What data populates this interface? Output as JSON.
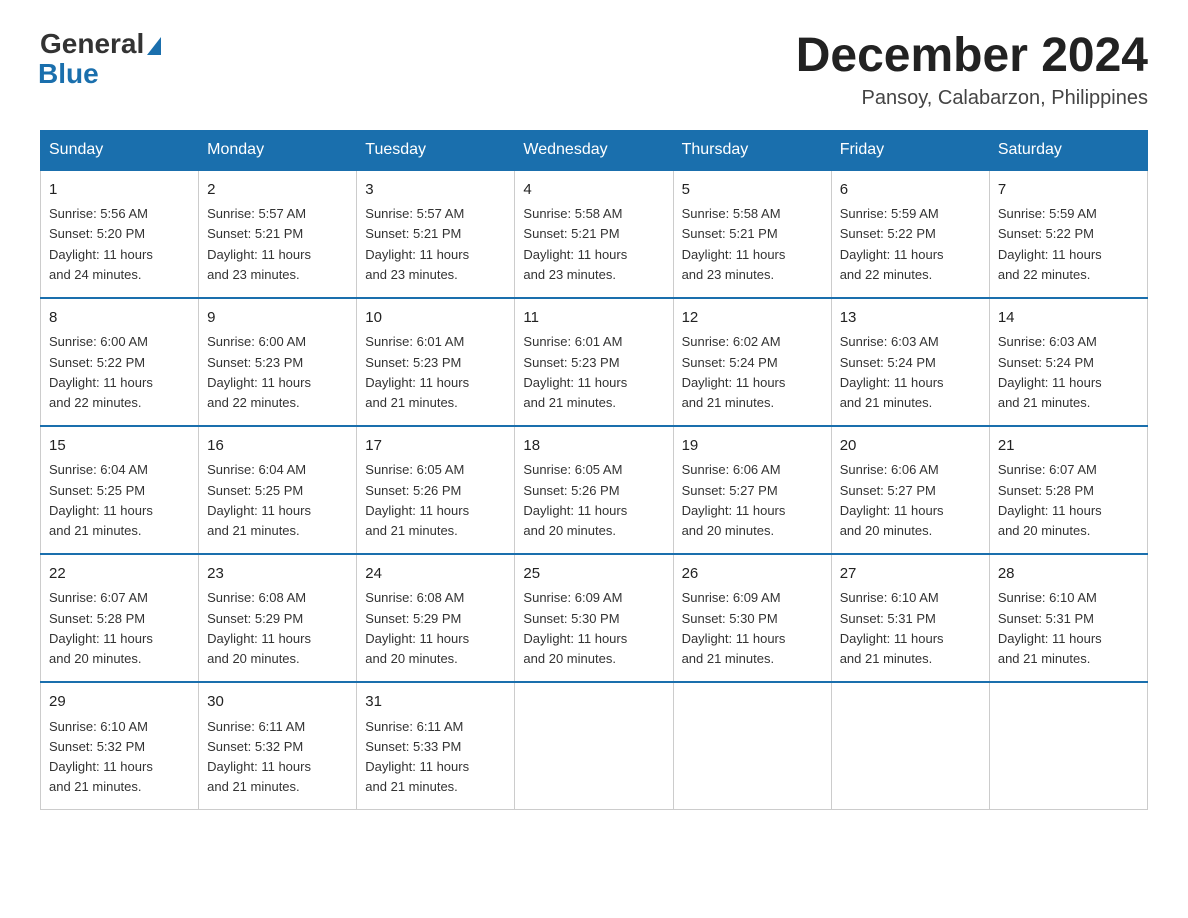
{
  "header": {
    "logo_general": "General",
    "logo_blue": "Blue",
    "month_title": "December 2024",
    "subtitle": "Pansoy, Calabarzon, Philippines"
  },
  "weekdays": [
    "Sunday",
    "Monday",
    "Tuesday",
    "Wednesday",
    "Thursday",
    "Friday",
    "Saturday"
  ],
  "weeks": [
    [
      {
        "day": "1",
        "sunrise": "5:56 AM",
        "sunset": "5:20 PM",
        "daylight": "11 hours and 24 minutes."
      },
      {
        "day": "2",
        "sunrise": "5:57 AM",
        "sunset": "5:21 PM",
        "daylight": "11 hours and 23 minutes."
      },
      {
        "day": "3",
        "sunrise": "5:57 AM",
        "sunset": "5:21 PM",
        "daylight": "11 hours and 23 minutes."
      },
      {
        "day": "4",
        "sunrise": "5:58 AM",
        "sunset": "5:21 PM",
        "daylight": "11 hours and 23 minutes."
      },
      {
        "day": "5",
        "sunrise": "5:58 AM",
        "sunset": "5:21 PM",
        "daylight": "11 hours and 23 minutes."
      },
      {
        "day": "6",
        "sunrise": "5:59 AM",
        "sunset": "5:22 PM",
        "daylight": "11 hours and 22 minutes."
      },
      {
        "day": "7",
        "sunrise": "5:59 AM",
        "sunset": "5:22 PM",
        "daylight": "11 hours and 22 minutes."
      }
    ],
    [
      {
        "day": "8",
        "sunrise": "6:00 AM",
        "sunset": "5:22 PM",
        "daylight": "11 hours and 22 minutes."
      },
      {
        "day": "9",
        "sunrise": "6:00 AM",
        "sunset": "5:23 PM",
        "daylight": "11 hours and 22 minutes."
      },
      {
        "day": "10",
        "sunrise": "6:01 AM",
        "sunset": "5:23 PM",
        "daylight": "11 hours and 21 minutes."
      },
      {
        "day": "11",
        "sunrise": "6:01 AM",
        "sunset": "5:23 PM",
        "daylight": "11 hours and 21 minutes."
      },
      {
        "day": "12",
        "sunrise": "6:02 AM",
        "sunset": "5:24 PM",
        "daylight": "11 hours and 21 minutes."
      },
      {
        "day": "13",
        "sunrise": "6:03 AM",
        "sunset": "5:24 PM",
        "daylight": "11 hours and 21 minutes."
      },
      {
        "day": "14",
        "sunrise": "6:03 AM",
        "sunset": "5:24 PM",
        "daylight": "11 hours and 21 minutes."
      }
    ],
    [
      {
        "day": "15",
        "sunrise": "6:04 AM",
        "sunset": "5:25 PM",
        "daylight": "11 hours and 21 minutes."
      },
      {
        "day": "16",
        "sunrise": "6:04 AM",
        "sunset": "5:25 PM",
        "daylight": "11 hours and 21 minutes."
      },
      {
        "day": "17",
        "sunrise": "6:05 AM",
        "sunset": "5:26 PM",
        "daylight": "11 hours and 21 minutes."
      },
      {
        "day": "18",
        "sunrise": "6:05 AM",
        "sunset": "5:26 PM",
        "daylight": "11 hours and 20 minutes."
      },
      {
        "day": "19",
        "sunrise": "6:06 AM",
        "sunset": "5:27 PM",
        "daylight": "11 hours and 20 minutes."
      },
      {
        "day": "20",
        "sunrise": "6:06 AM",
        "sunset": "5:27 PM",
        "daylight": "11 hours and 20 minutes."
      },
      {
        "day": "21",
        "sunrise": "6:07 AM",
        "sunset": "5:28 PM",
        "daylight": "11 hours and 20 minutes."
      }
    ],
    [
      {
        "day": "22",
        "sunrise": "6:07 AM",
        "sunset": "5:28 PM",
        "daylight": "11 hours and 20 minutes."
      },
      {
        "day": "23",
        "sunrise": "6:08 AM",
        "sunset": "5:29 PM",
        "daylight": "11 hours and 20 minutes."
      },
      {
        "day": "24",
        "sunrise": "6:08 AM",
        "sunset": "5:29 PM",
        "daylight": "11 hours and 20 minutes."
      },
      {
        "day": "25",
        "sunrise": "6:09 AM",
        "sunset": "5:30 PM",
        "daylight": "11 hours and 20 minutes."
      },
      {
        "day": "26",
        "sunrise": "6:09 AM",
        "sunset": "5:30 PM",
        "daylight": "11 hours and 21 minutes."
      },
      {
        "day": "27",
        "sunrise": "6:10 AM",
        "sunset": "5:31 PM",
        "daylight": "11 hours and 21 minutes."
      },
      {
        "day": "28",
        "sunrise": "6:10 AM",
        "sunset": "5:31 PM",
        "daylight": "11 hours and 21 minutes."
      }
    ],
    [
      {
        "day": "29",
        "sunrise": "6:10 AM",
        "sunset": "5:32 PM",
        "daylight": "11 hours and 21 minutes."
      },
      {
        "day": "30",
        "sunrise": "6:11 AM",
        "sunset": "5:32 PM",
        "daylight": "11 hours and 21 minutes."
      },
      {
        "day": "31",
        "sunrise": "6:11 AM",
        "sunset": "5:33 PM",
        "daylight": "11 hours and 21 minutes."
      },
      null,
      null,
      null,
      null
    ]
  ],
  "labels": {
    "sunrise": "Sunrise:",
    "sunset": "Sunset:",
    "daylight": "Daylight:"
  }
}
